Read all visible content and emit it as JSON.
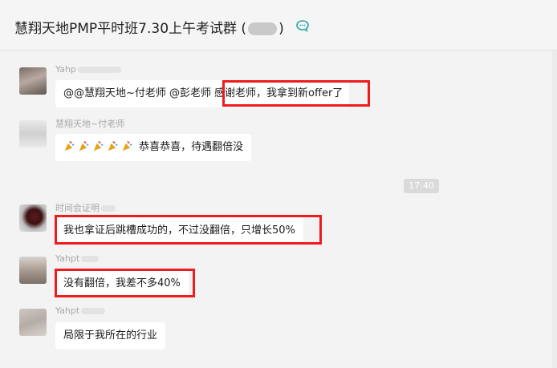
{
  "header": {
    "title_prefix": "慧翔天地PMP平时班7.30上午考试群 (",
    "title_suffix": ")",
    "chat_icon": "group-chat-icon"
  },
  "time_divider": "17:40",
  "messages": [
    {
      "sender": "Yahp",
      "text_pre": "@@慧翔天地~付老师 @彭老师",
      "text_highlight": "感谢老师，我拿到新offer了"
    },
    {
      "sender": "慧翔天地~付老师",
      "emoji": "party-popper-icon",
      "emoji_count": 5,
      "text": "恭喜恭喜，待遇翻倍没"
    },
    {
      "sender": "时间会证明",
      "text": "我也拿证后跳槽成功的，不过没翻倍，只增长50%"
    },
    {
      "sender": "Yahpt",
      "text": "没有翻倍，我差不多40%"
    },
    {
      "sender": "Yahpt",
      "text": "局限于我所在的行业"
    }
  ],
  "colors": {
    "highlight": "#ee1c1c",
    "bubble": "#ffffff",
    "background": "#f3f3f3"
  }
}
